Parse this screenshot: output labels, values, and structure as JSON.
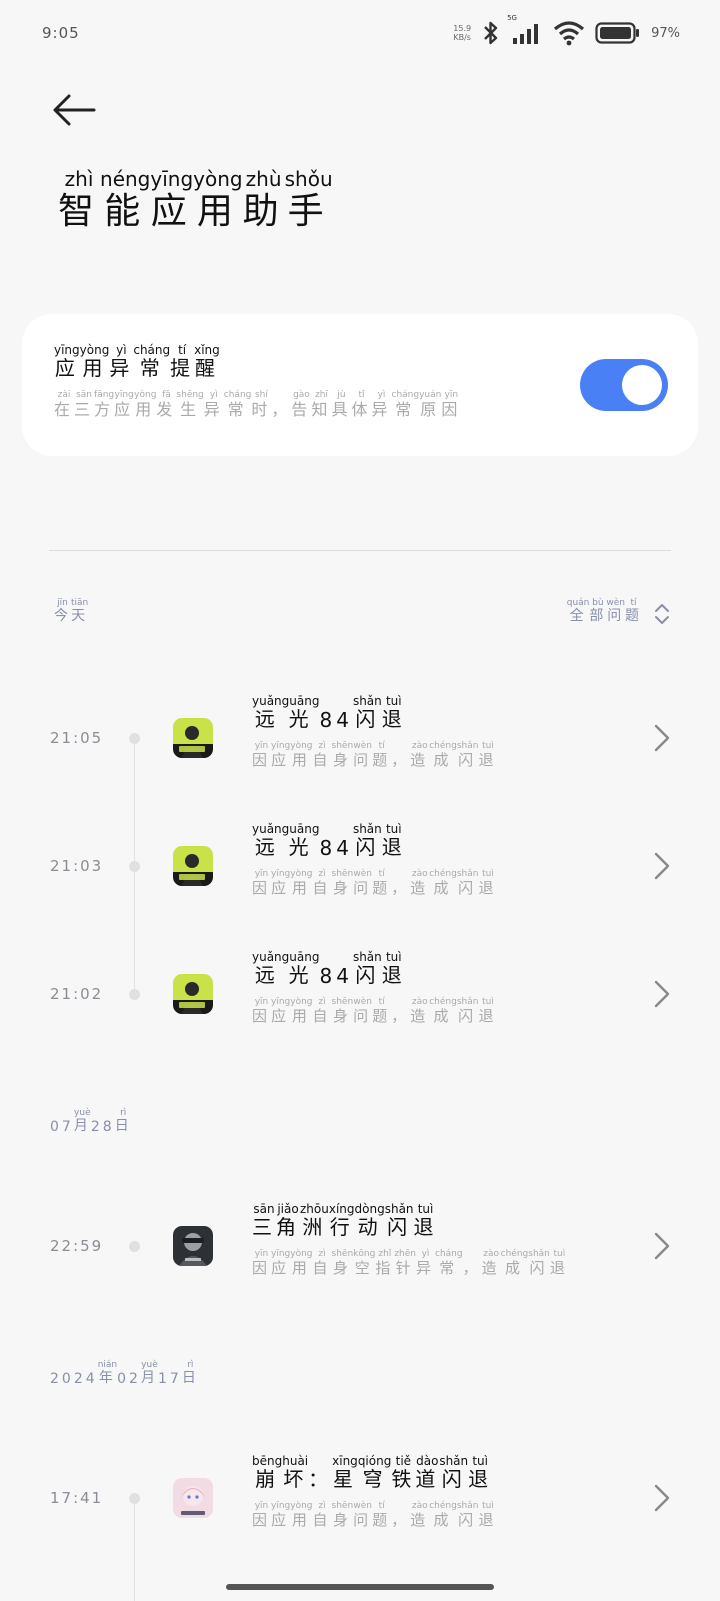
{
  "status_bar": {
    "time": "9:05",
    "net_speed_value": "15.9",
    "net_speed_unit": "KB/s",
    "signal_label": "5G",
    "battery_percent": "97%"
  },
  "header": {
    "title": {
      "chars": [
        "智",
        "能",
        "应",
        "用",
        "助",
        "手"
      ],
      "pinyin": [
        "zhì",
        "néng",
        "yīng",
        "yòng",
        "zhù",
        "shǒu"
      ]
    }
  },
  "setting_card": {
    "title": {
      "chars": [
        "应",
        "用",
        "异",
        "常",
        "提",
        "醒"
      ],
      "pinyin": [
        "yīng",
        "yòng",
        "yì",
        "cháng",
        "tí",
        "xǐng"
      ]
    },
    "description": {
      "chars": [
        "在",
        "三",
        "方",
        "应",
        "用",
        "发",
        "生",
        "异",
        "常",
        "时",
        "，",
        "告",
        "知",
        "具",
        "体",
        "异",
        "常",
        "原",
        "因"
      ],
      "pinyin": [
        "zài",
        "sān",
        "fāng",
        "yīng",
        "yòng",
        "fā",
        "shēng",
        "yì",
        "cháng",
        "shí",
        "",
        "gào",
        "zhī",
        "jù",
        "tǐ",
        "yì",
        "cháng",
        "yuán",
        "yīn"
      ]
    },
    "toggle_on": true,
    "accent_color": "#4a80f5"
  },
  "list_header": {
    "today": {
      "chars": [
        "今",
        "天"
      ],
      "pinyin": [
        "jīn",
        "tiān"
      ]
    },
    "filter": {
      "chars": [
        "全",
        "部",
        "问",
        "题"
      ],
      "pinyin": [
        "quán",
        "bù",
        "wèn",
        "tí"
      ]
    }
  },
  "groups": [
    {
      "date": null,
      "entries": [
        {
          "time": "21:05",
          "icon": "guangyu-84-icon",
          "title": {
            "chars": [
              "远",
              "光",
              "8",
              "4",
              "闪",
              "退"
            ],
            "pinyin": [
              "yuǎn",
              "guāng",
              "",
              "",
              "shǎn",
              "tuì"
            ]
          },
          "desc": {
            "chars": [
              "因",
              "应",
              "用",
              "自",
              "身",
              "问",
              "题",
              "，",
              "造",
              "成",
              "闪",
              "退"
            ],
            "pinyin": [
              "yīn",
              "yīng",
              "yòng",
              "zì",
              "shēn",
              "wèn",
              "tí",
              "",
              "zào",
              "chéng",
              "shǎn",
              "tuì"
            ]
          }
        },
        {
          "time": "21:03",
          "icon": "guangyu-84-icon",
          "title": {
            "chars": [
              "远",
              "光",
              "8",
              "4",
              "闪",
              "退"
            ],
            "pinyin": [
              "yuǎn",
              "guāng",
              "",
              "",
              "shǎn",
              "tuì"
            ]
          },
          "desc": {
            "chars": [
              "因",
              "应",
              "用",
              "自",
              "身",
              "问",
              "题",
              "，",
              "造",
              "成",
              "闪",
              "退"
            ],
            "pinyin": [
              "yīn",
              "yīng",
              "yòng",
              "zì",
              "shēn",
              "wèn",
              "tí",
              "",
              "zào",
              "chéng",
              "shǎn",
              "tuì"
            ]
          }
        },
        {
          "time": "21:02",
          "icon": "guangyu-84-icon",
          "title": {
            "chars": [
              "远",
              "光",
              "8",
              "4",
              "闪",
              "退"
            ],
            "pinyin": [
              "yuǎn",
              "guāng",
              "",
              "",
              "shǎn",
              "tuì"
            ]
          },
          "desc": {
            "chars": [
              "因",
              "应",
              "用",
              "自",
              "身",
              "问",
              "题",
              "，",
              "造",
              "成",
              "闪",
              "退"
            ],
            "pinyin": [
              "yīn",
              "yīng",
              "yòng",
              "zì",
              "shēn",
              "wèn",
              "tí",
              "",
              "zào",
              "chéng",
              "shǎn",
              "tuì"
            ]
          }
        }
      ]
    },
    {
      "date": {
        "chars": [
          "0",
          "7",
          "月",
          "2",
          "8",
          "日"
        ],
        "pinyin": [
          "",
          "",
          "yuè",
          "",
          "",
          "rì"
        ]
      },
      "entries": [
        {
          "time": "22:59",
          "icon": "delta-force-icon",
          "title": {
            "chars": [
              "三",
              "角",
              "洲",
              "行",
              "动",
              "闪",
              "退"
            ],
            "pinyin": [
              "sān",
              "jiǎo",
              "zhōu",
              "xíng",
              "dòng",
              "shǎn",
              "tuì"
            ]
          },
          "desc": {
            "chars": [
              "因",
              "应",
              "用",
              "自",
              "身",
              "空",
              "指",
              "针",
              "异",
              "常",
              "，",
              "造",
              "成",
              "闪",
              "退"
            ],
            "pinyin": [
              "yīn",
              "yīng",
              "yòng",
              "zì",
              "shēn",
              "kōng",
              "zhǐ",
              "zhēn",
              "yì",
              "cháng",
              "",
              "zào",
              "chéng",
              "shǎn",
              "tuì"
            ]
          }
        }
      ]
    },
    {
      "date": {
        "chars": [
          "2",
          "0",
          "2",
          "4",
          "年",
          "0",
          "2",
          "月",
          "1",
          "7",
          "日"
        ],
        "pinyin": [
          "",
          "",
          "",
          "",
          "nián",
          "",
          "",
          "yuè",
          "",
          "",
          "rì"
        ]
      },
      "entries": [
        {
          "time": "17:41",
          "icon": "honkai-star-rail-icon",
          "title": {
            "chars": [
              "崩",
              "坏",
              "：",
              "星",
              "穹",
              "铁",
              "道",
              "闪",
              "退"
            ],
            "pinyin": [
              "bēng",
              "huài",
              "",
              "xīng",
              "qióng",
              "tiě",
              "dào",
              "shǎn",
              "tuì"
            ]
          },
          "desc": {
            "chars": [
              "因",
              "应",
              "用",
              "自",
              "身",
              "问",
              "题",
              "，",
              "造",
              "成",
              "闪",
              "退"
            ],
            "pinyin": [
              "yīn",
              "yīng",
              "yòng",
              "zì",
              "shēn",
              "wèn",
              "tí",
              "",
              "zào",
              "chéng",
              "shǎn",
              "tuì"
            ]
          }
        }
      ]
    }
  ]
}
